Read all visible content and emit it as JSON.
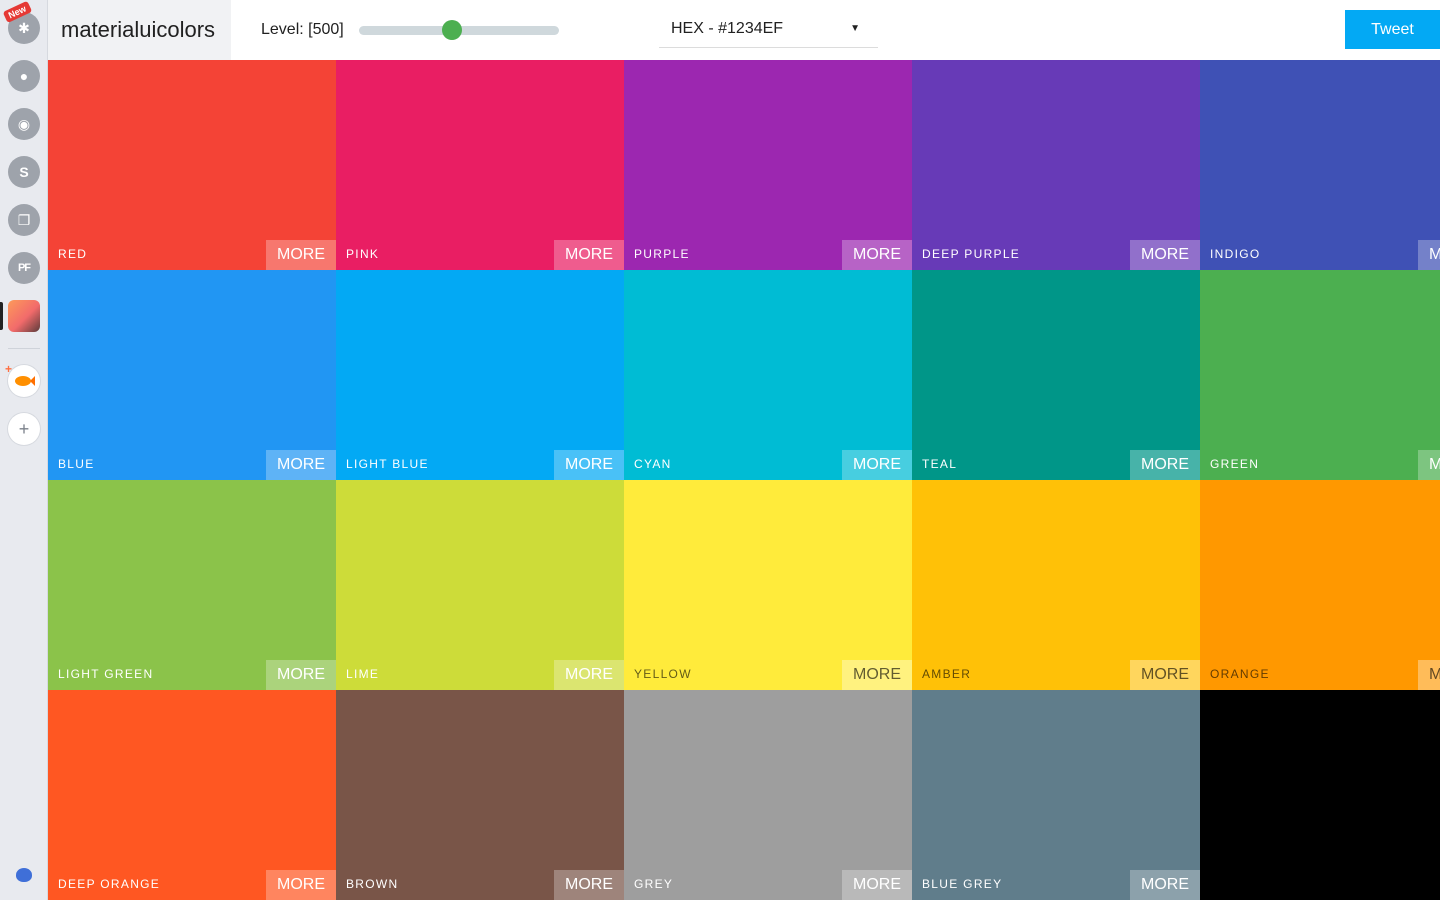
{
  "dock": {
    "new_badge": "New",
    "items": [
      {
        "name": "slack-icon",
        "glyph": "✱"
      },
      {
        "name": "bear-icon",
        "glyph": "●"
      },
      {
        "name": "palette-icon",
        "glyph": "◉"
      },
      {
        "name": "s-app-icon",
        "glyph": "S"
      },
      {
        "name": "copy-stack-icon",
        "glyph": "❐"
      },
      {
        "name": "pf-app-icon",
        "glyph": "PF"
      }
    ],
    "plus_badge": "+"
  },
  "header": {
    "brand": "materialuicolors",
    "level_label": "Level: [500]",
    "level_fraction": 0.465,
    "format_selected": "HEX - #1234EF",
    "tweet_label": "Tweet"
  },
  "colors": [
    {
      "name": "RED",
      "hex": "#f44336",
      "more": "MORE",
      "dark": false
    },
    {
      "name": "PINK",
      "hex": "#e91e63",
      "more": "MORE",
      "dark": false
    },
    {
      "name": "PURPLE",
      "hex": "#9c27b0",
      "more": "MORE",
      "dark": false
    },
    {
      "name": "DEEP PURPLE",
      "hex": "#673ab7",
      "more": "MORE",
      "dark": false
    },
    {
      "name": "INDIGO",
      "hex": "#3f51b5",
      "more": "MORE",
      "dark": false
    },
    {
      "name": "BLUE",
      "hex": "#2196f3",
      "more": "MORE",
      "dark": false
    },
    {
      "name": "LIGHT BLUE",
      "hex": "#03a9f4",
      "more": "MORE",
      "dark": false
    },
    {
      "name": "CYAN",
      "hex": "#00bcd4",
      "more": "MORE",
      "dark": false
    },
    {
      "name": "TEAL",
      "hex": "#009688",
      "more": "MORE",
      "dark": false
    },
    {
      "name": "GREEN",
      "hex": "#4caf50",
      "more": "MORE",
      "dark": false
    },
    {
      "name": "LIGHT GREEN",
      "hex": "#8bc34a",
      "more": "MORE",
      "dark": false
    },
    {
      "name": "LIME",
      "hex": "#cddc39",
      "more": "MORE",
      "dark": false
    },
    {
      "name": "YELLOW",
      "hex": "#ffeb3b",
      "more": "MORE",
      "dark": true
    },
    {
      "name": "AMBER",
      "hex": "#ffc107",
      "more": "MORE",
      "dark": true
    },
    {
      "name": "ORANGE",
      "hex": "#ff9800",
      "more": "MORE",
      "dark": true
    },
    {
      "name": "DEEP ORANGE",
      "hex": "#ff5722",
      "more": "MORE",
      "dark": false
    },
    {
      "name": "BROWN",
      "hex": "#795548",
      "more": "MORE",
      "dark": false
    },
    {
      "name": "GREY",
      "hex": "#9e9e9e",
      "more": "MORE",
      "dark": false
    },
    {
      "name": "BLUE GREY",
      "hex": "#607d8b",
      "more": "MORE",
      "dark": false
    },
    {
      "name": "",
      "hex": "#000000",
      "more": "",
      "dark": false
    }
  ]
}
